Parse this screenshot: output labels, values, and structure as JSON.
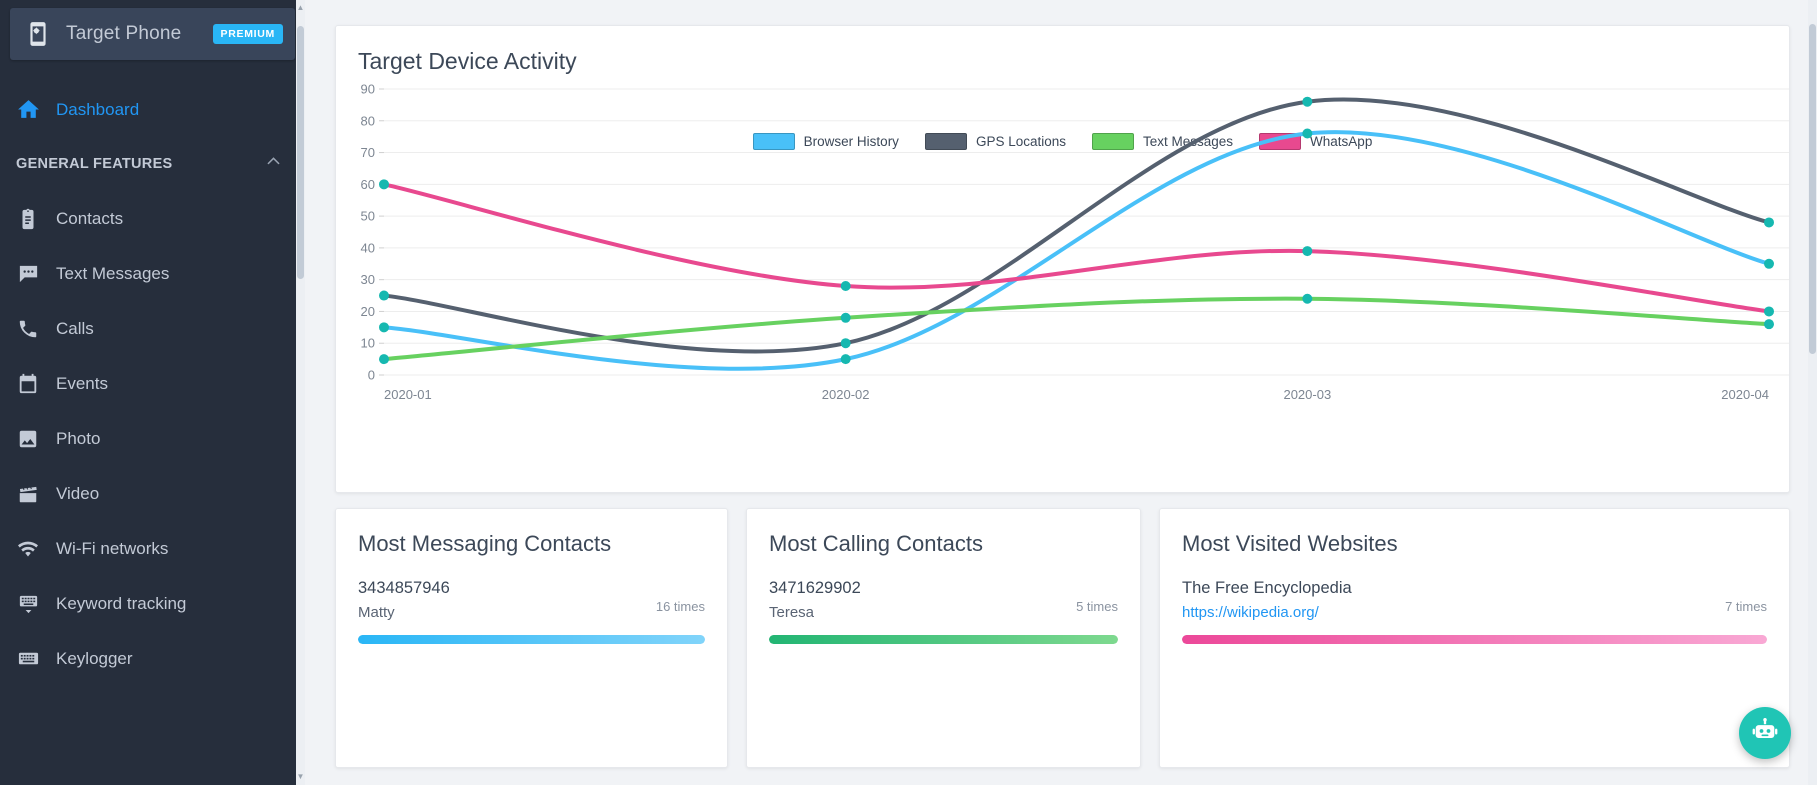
{
  "sidebar": {
    "brand": {
      "title": "Target Phone",
      "badge": "PREMIUM",
      "icon": "phone-settings-icon"
    },
    "dashboard": {
      "label": "Dashboard",
      "icon": "home-icon"
    },
    "section": {
      "label": "GENERAL FEATURES",
      "chevron": "chevron-up-icon"
    },
    "items": [
      {
        "label": "Contacts",
        "icon": "contacts-clipboard-icon"
      },
      {
        "label": "Text Messages",
        "icon": "message-bubble-icon"
      },
      {
        "label": "Calls",
        "icon": "phone-handset-icon"
      },
      {
        "label": "Events",
        "icon": "calendar-icon"
      },
      {
        "label": "Photo",
        "icon": "image-icon"
      },
      {
        "label": "Video",
        "icon": "clapperboard-icon"
      },
      {
        "label": "Wi-Fi networks",
        "icon": "wifi-icon"
      },
      {
        "label": "Keyword tracking",
        "icon": "keyboard-down-icon"
      },
      {
        "label": "Keylogger",
        "icon": "keyboard-icon"
      }
    ]
  },
  "chart_data": {
    "type": "line",
    "title": "Target Device Activity",
    "xlabel": "",
    "ylabel": "",
    "categories": [
      "2020-01",
      "2020-02",
      "2020-03",
      "2020-04"
    ],
    "ylim": [
      0,
      90
    ],
    "yticks": [
      0,
      10,
      20,
      30,
      40,
      50,
      60,
      70,
      80,
      90
    ],
    "grid": true,
    "legend_position": "top-center",
    "point_marker_color": "#16b8b0",
    "series": [
      {
        "name": "Browser History",
        "color": "#49c0f8",
        "values": [
          15,
          5,
          76,
          35
        ]
      },
      {
        "name": "GPS Locations",
        "color": "#55606f",
        "values": [
          25,
          10,
          86,
          48
        ]
      },
      {
        "name": "Text Messages",
        "color": "#67d160",
        "values": [
          5,
          18,
          24,
          16
        ]
      },
      {
        "name": "WhatsApp",
        "color": "#e8498f",
        "values": [
          60,
          28,
          39,
          20
        ]
      }
    ]
  },
  "cards": {
    "messaging": {
      "title": "Most Messaging Contacts",
      "rows": [
        {
          "primary": "3434857946",
          "secondary": "Matty",
          "times": "16 times",
          "bar_pct": 100,
          "bar_from": "#29b6f6",
          "bar_to": "#81d4fa"
        }
      ]
    },
    "calling": {
      "title": "Most Calling Contacts",
      "rows": [
        {
          "primary": "3471629902",
          "secondary": "Teresa",
          "times": "5 times",
          "bar_pct": 100,
          "bar_from": "#22b573",
          "bar_to": "#7ed98f"
        }
      ]
    },
    "websites": {
      "title": "Most Visited Websites",
      "rows": [
        {
          "primary": "The Free Encyclopedia",
          "secondary": "https://wikipedia.org/",
          "times": "7 times",
          "bar_pct": 100,
          "bar_from": "#ec4899",
          "bar_to": "#f9a8d4"
        }
      ]
    }
  },
  "fab": {
    "icon": "chat-robot-icon",
    "color": "#20c5b5"
  }
}
